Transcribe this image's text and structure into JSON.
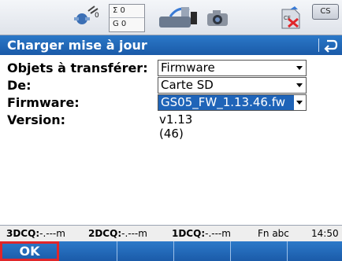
{
  "statusbar": {
    "counter": {
      "row1": "Σ 0",
      "row2": "G 0"
    },
    "cs_label": "CS",
    "icons": [
      "satellite-icon",
      "counter-icon",
      "radio-icon",
      "camera-icon",
      "sd-card-error-icon",
      "cs-icon"
    ]
  },
  "titlebar": {
    "title": "Charger mise à jour",
    "back_icon": "return-arrow-icon"
  },
  "form": {
    "objects_label": "Objets à transférer:",
    "objects_value": "Firmware",
    "from_label": "De:",
    "from_value": "Carte SD",
    "firmware_label": "Firmware:",
    "firmware_value": "GS05_FW_1.13.46.fw",
    "version_label": "Version:",
    "version_value": "v1.13 (46)"
  },
  "infobar": {
    "q3d_label": "3DCQ:",
    "q3d_value": "-.---m",
    "q2d_label": "2DCQ:",
    "q2d_value": "-.---m",
    "q1d_label": "1DCQ:",
    "q1d_value": "-.---m",
    "mode": "Fn abc",
    "time": "14:50"
  },
  "softkeys": {
    "ok_label": "OK",
    "highlight_color": "#e0262a"
  },
  "colors": {
    "accent": "#1f64b8",
    "titlebar": "#2268b9"
  }
}
